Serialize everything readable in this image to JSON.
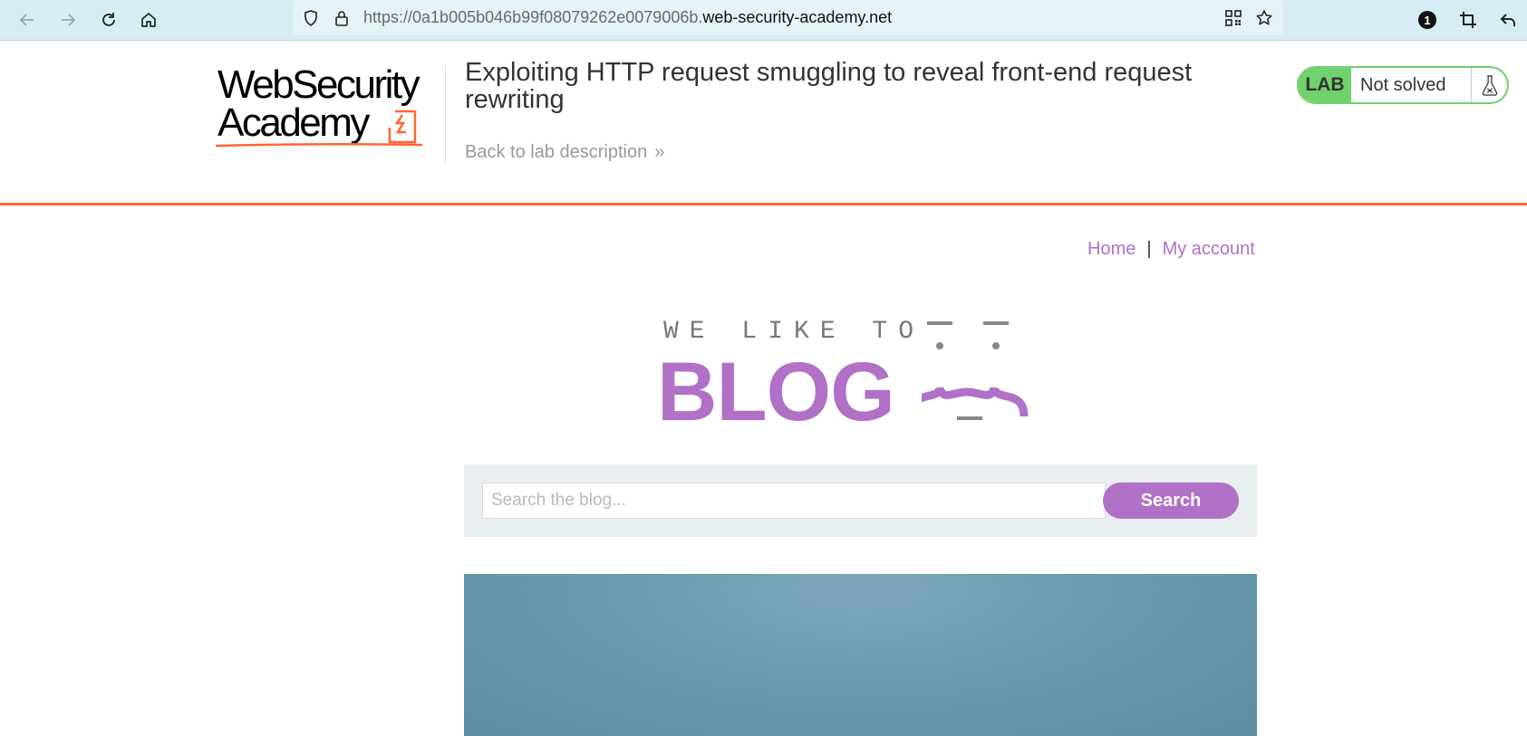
{
  "browser": {
    "url_prefix": "https://0a1b005b046b99f08079262e0079006b.",
    "url_domain": "web-security-academy.net",
    "notification_count": "1"
  },
  "lab": {
    "logo_line1": "WebSecurity",
    "logo_line2": "Academy",
    "title": "Exploiting HTTP request smuggling to reveal front-end request rewriting",
    "back_link": "Back to lab description",
    "badge": "LAB",
    "status": "Not solved",
    "colors": {
      "accent": "#ff6633",
      "lab_green": "#70d16d"
    }
  },
  "site": {
    "nav": {
      "home": "Home",
      "separator": "|",
      "my_account": "My account"
    },
    "logo": {
      "tagline": "WE LIKE TO",
      "word": "BLOG"
    },
    "search": {
      "placeholder": "Search the blog...",
      "button": "Search"
    },
    "colors": {
      "purple": "#b071c6",
      "panel": "#e9eef1"
    }
  }
}
